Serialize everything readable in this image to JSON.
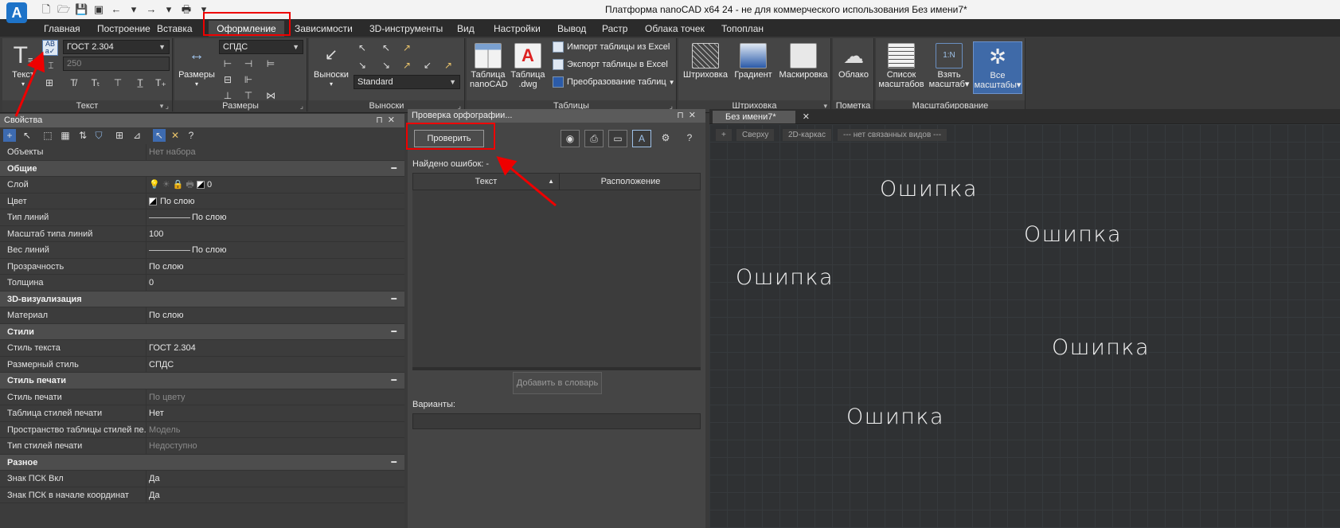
{
  "window": {
    "title": "Платформа nanoCAD x64 24 - не для коммерческого использования Без имени7*",
    "app_logo_glyph": "A"
  },
  "menu": {
    "tabs": [
      "Главная",
      "Построение",
      "Вставка",
      "Оформление",
      "Зависимости",
      "3D-инструменты",
      "Вид",
      "Настройки",
      "Вывод",
      "Растр",
      "Облака точек",
      "Топоплан"
    ],
    "active": "Оформление"
  },
  "ribbon": {
    "text_group": {
      "title": "Текст",
      "big_label": "Текст",
      "style_combo": "ГОСТ 2.304",
      "height_combo": "250"
    },
    "dims_group": {
      "title": "Размеры",
      "big_label": "Размеры",
      "style_combo": "СПДС"
    },
    "leaders_group": {
      "title": "Выноски",
      "big_label": "Выноски",
      "style_combo": "Standard"
    },
    "tables_group": {
      "title": "Таблицы",
      "btn_nanocad": "Таблица nanoCAD",
      "btn_dwg": "Таблица .dwg",
      "import_excel": "Импорт таблицы из Excel",
      "export_excel": "Экспорт таблицы в Excel",
      "convert": "Преобразование таблиц"
    },
    "hatch_group": {
      "title": "Штриховка",
      "hatch": "Штриховка",
      "gradient": "Градиент",
      "mask": "Маскировка"
    },
    "markup_group": {
      "title": "Пометка",
      "cloud": "Облако"
    },
    "scale_group": {
      "title": "Масштабирование",
      "list": "Список масштабов",
      "take": "Взять масштаб",
      "take_icon_text": "1:N",
      "all": "Все масштабы"
    }
  },
  "properties": {
    "title": "Свойства",
    "rows": [
      {
        "k": "Объекты",
        "v": "Нет набора",
        "dim": true
      },
      {
        "k": "Общие",
        "section": true
      },
      {
        "k": "Слой",
        "v": "0",
        "layer": true
      },
      {
        "k": "Цвет",
        "v": "По слою",
        "swatch": true
      },
      {
        "k": "Тип линий",
        "v": "По слою",
        "line": true
      },
      {
        "k": "Масштаб типа линий",
        "v": "100"
      },
      {
        "k": "Вес линий",
        "v": "По слою",
        "line": true
      },
      {
        "k": "Прозрачность",
        "v": "По слою"
      },
      {
        "k": "Толщина",
        "v": "0"
      },
      {
        "k": "3D-визуализация",
        "section": true
      },
      {
        "k": "Материал",
        "v": "По слою"
      },
      {
        "k": "Стили",
        "section": true
      },
      {
        "k": "Стиль текста",
        "v": "ГОСТ 2.304"
      },
      {
        "k": "Размерный стиль",
        "v": "СПДС"
      },
      {
        "k": "Стиль печати",
        "section": true
      },
      {
        "k": "Стиль печати",
        "v": "По цвету",
        "dim": true
      },
      {
        "k": "Таблица стилей печати",
        "v": "Нет"
      },
      {
        "k": "Пространство таблицы стилей пе...",
        "v": "Модель",
        "dim": true
      },
      {
        "k": "Тип стилей печати",
        "v": "Недоступно",
        "dim": true
      },
      {
        "k": "Разное",
        "section": true
      },
      {
        "k": "Знак ПСК Вкл",
        "v": "Да"
      },
      {
        "k": "Знак ПСК в начале координат",
        "v": "Да"
      }
    ]
  },
  "spellcheck": {
    "title": "Проверка орфографии...",
    "check_button": "Проверить",
    "found_label": "Найдено ошибок: -",
    "col_text": "Текст",
    "col_location": "Расположение",
    "add_to_dict": "Добавить в словарь",
    "variants_label": "Варианты:"
  },
  "document": {
    "tab_title": "Без имени7*",
    "view_controls": [
      "+",
      "Сверху",
      "2D-каркас",
      "--- нет связанных видов ---"
    ],
    "texts": [
      {
        "label": "Ошипка"
      },
      {
        "label": "Ошипка"
      },
      {
        "label": "Ошипка"
      },
      {
        "label": "Ошипка"
      },
      {
        "label": "Ошипка"
      }
    ]
  },
  "colors": {
    "accent_blue": "#1e73c8",
    "highlight_red": "#e00000"
  }
}
